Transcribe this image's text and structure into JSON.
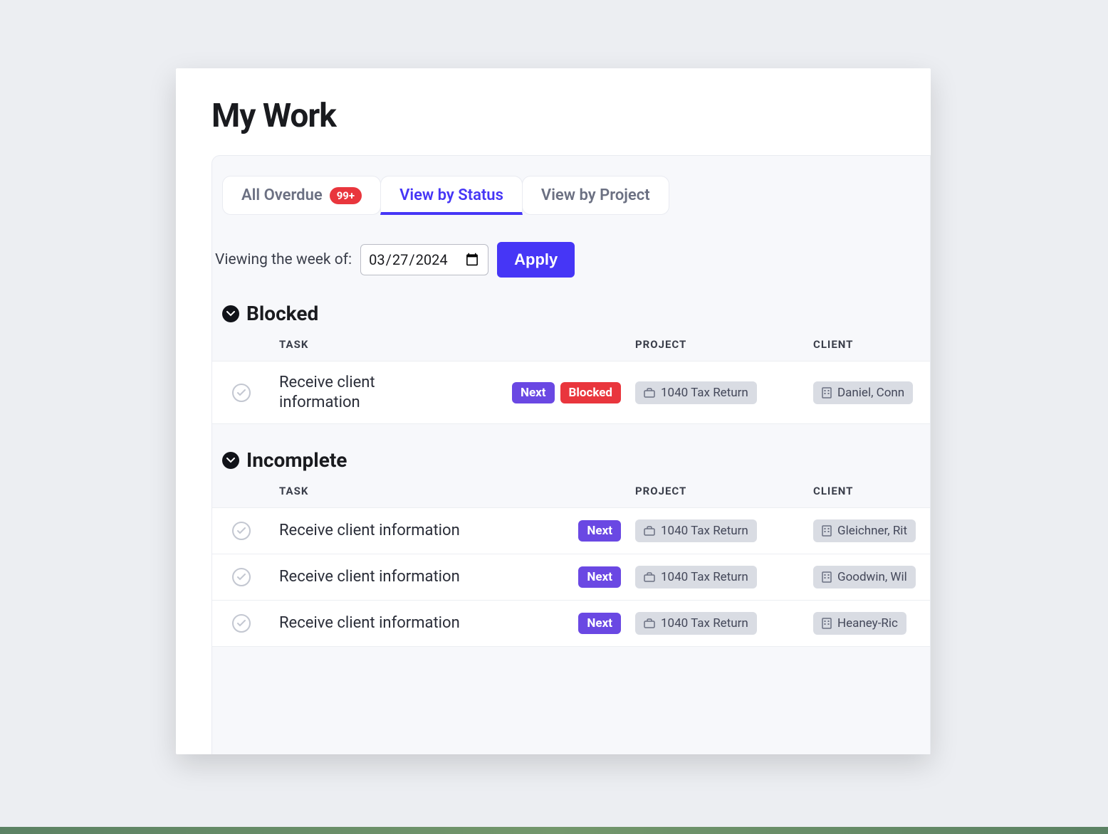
{
  "title": "My Work",
  "tabs": [
    {
      "label": "All Overdue",
      "badge": "99+"
    },
    {
      "label": "View by Status"
    },
    {
      "label": "View by Project"
    }
  ],
  "weekRow": {
    "label": "Viewing the week of:",
    "date": "2024-03-27",
    "dateDisplay": "03/27/2024",
    "apply": "Apply"
  },
  "columns": {
    "task": "TASK",
    "project": "PROJECT",
    "client": "CLIENT"
  },
  "sections": [
    {
      "title": "Blocked",
      "rows": [
        {
          "task": "Receive client information",
          "taskWrap": true,
          "chips": [
            {
              "label": "Next",
              "color": "purple"
            },
            {
              "label": "Blocked",
              "color": "red"
            }
          ],
          "project": "1040 Tax Return",
          "client": "Daniel, Conn"
        }
      ]
    },
    {
      "title": "Incomplete",
      "rows": [
        {
          "task": "Receive client information",
          "chips": [
            {
              "label": "Next",
              "color": "purple"
            }
          ],
          "project": "1040 Tax Return",
          "client": "Gleichner, Rit"
        },
        {
          "task": "Receive client information",
          "chips": [
            {
              "label": "Next",
              "color": "purple"
            }
          ],
          "project": "1040 Tax Return",
          "client": "Goodwin, Wil"
        },
        {
          "task": "Receive client information",
          "chips": [
            {
              "label": "Next",
              "color": "purple"
            }
          ],
          "project": "1040 Tax Return",
          "client": "Heaney-Ric"
        }
      ]
    }
  ]
}
